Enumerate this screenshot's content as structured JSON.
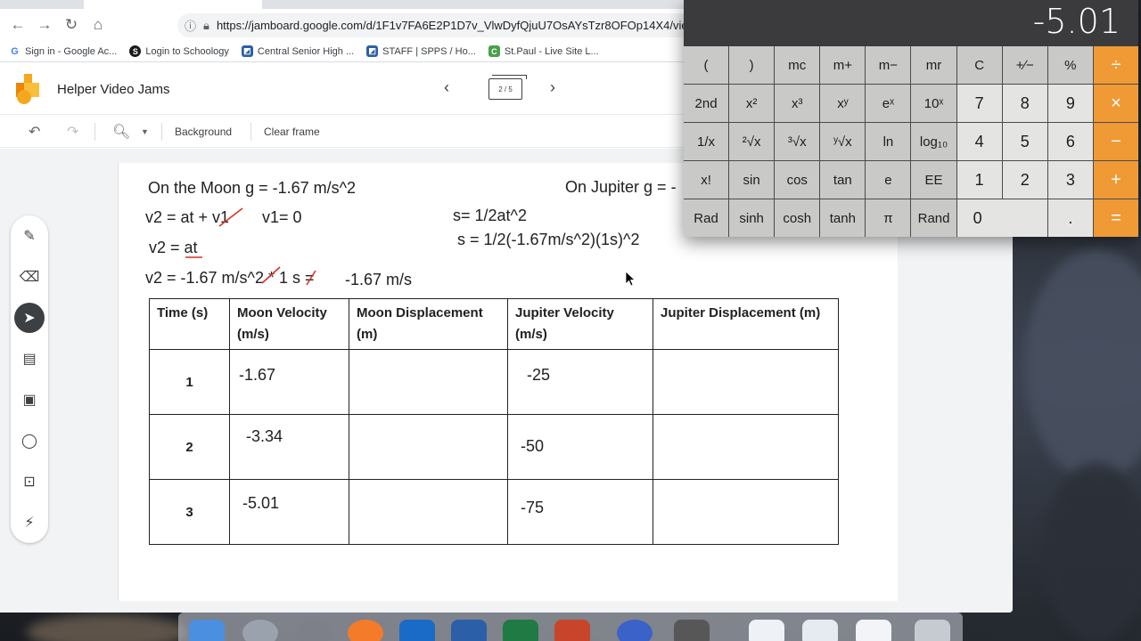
{
  "browser": {
    "url": "https://jamboard.google.com/d/1F1v7FA6E2P1D7v_VlwDyfQjuU7OsAYsTzr8OFOp14X4/viewer",
    "bookmarks": [
      {
        "label": "Sign in - Google Ac...",
        "icon": "google-icon",
        "color": "#4285f4"
      },
      {
        "label": "Login to Schoology",
        "icon": "schoology-icon",
        "color": "#1a1a1a"
      },
      {
        "label": "Central Senior High ...",
        "icon": "school-icon",
        "color": "#2b5fa8"
      },
      {
        "label": "STAFF | SPPS / Ho...",
        "icon": "school-icon",
        "color": "#2b5fa8"
      },
      {
        "label": "St.Paul - Live Site L...",
        "icon": "classlink-icon",
        "color": "#4aa04a"
      }
    ]
  },
  "jamboard": {
    "title": "Helper Video Jams",
    "frame_counter": "2 / 5",
    "toolbar": {
      "background_label": "Background",
      "clear_frame_label": "Clear frame"
    }
  },
  "whiteboard": {
    "moon_gravity": "On the Moon g = -1.67 m/s^2",
    "jupiter_gravity": "On Jupiter g = -",
    "eq_v2": "v2 = at + v1",
    "eq_v1": "v1= 0",
    "eq_v2_at": "v2 = at",
    "eq_v2_calc": "v2 = -1.67 m/s^2 * 1 s =",
    "eq_v2_result": "-1.67 m/s",
    "eq_s": "s= 1/2at^2",
    "eq_s_calc": "s = 1/2(-1.67m/s^2)(1s)^2"
  },
  "table": {
    "headers": [
      "Time (s)",
      "Moon Velocity (m/s)",
      "Moon Displacement (m)",
      "Jupiter Velocity (m/s)",
      "Jupiter Displacement (m)"
    ],
    "rows": [
      {
        "time": "1",
        "moon_velocity": "-1.67",
        "moon_displacement": "",
        "jupiter_velocity": "-25",
        "jupiter_displacement": ""
      },
      {
        "time": "2",
        "moon_velocity": "-3.34",
        "moon_displacement": "",
        "jupiter_velocity": "-50",
        "jupiter_displacement": ""
      },
      {
        "time": "3",
        "moon_velocity": "-5.01",
        "moon_displacement": "",
        "jupiter_velocity": "-75",
        "jupiter_displacement": ""
      }
    ]
  },
  "calculator": {
    "display": "-5.01",
    "keys": [
      "(",
      ")",
      "mc",
      "m+",
      "m−",
      "mr",
      "C",
      "+∕−",
      "%",
      "÷",
      "2nd",
      "x²",
      "x³",
      "xʸ",
      "eˣ",
      "10ˣ",
      "7",
      "8",
      "9",
      "×",
      "1/x",
      "²√x",
      "³√x",
      "ʸ√x",
      "ln",
      "log₁₀",
      "4",
      "5",
      "6",
      "−",
      "x!",
      "sin",
      "cos",
      "tan",
      "e",
      "EE",
      "1",
      "2",
      "3",
      "+",
      "Rad",
      "sinh",
      "cosh",
      "tanh",
      "π",
      "Rand",
      "0",
      ".",
      "="
    ],
    "colors": {
      "operator": "#f09a36",
      "display_bg": "#3b3b3e"
    }
  },
  "colors": {
    "annotation_red": "#d93025"
  }
}
